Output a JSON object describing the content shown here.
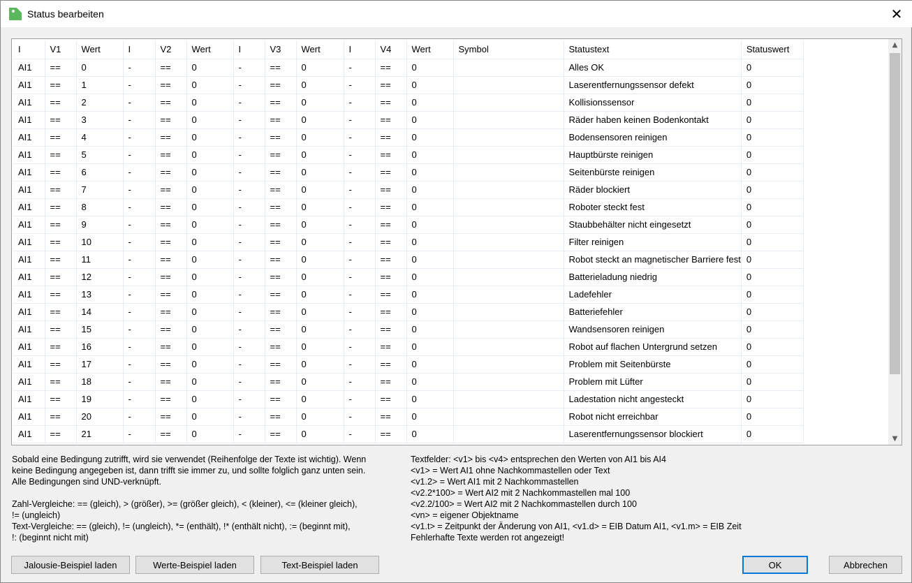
{
  "window": {
    "title": "Status bearbeiten",
    "close": "✕"
  },
  "table": {
    "headers": [
      "I",
      "V1",
      "Wert",
      "I",
      "V2",
      "Wert",
      "I",
      "V3",
      "Wert",
      "I",
      "V4",
      "Wert",
      "Symbol",
      "Statustext",
      "Statuswert"
    ],
    "rows": [
      [
        "AI1",
        "==",
        "0",
        "-",
        "==",
        "0",
        "-",
        "==",
        "0",
        "-",
        "==",
        "0",
        "",
        "Alles OK",
        "0"
      ],
      [
        "AI1",
        "==",
        "1",
        "-",
        "==",
        "0",
        "-",
        "==",
        "0",
        "-",
        "==",
        "0",
        "",
        "Laserentfernungssensor defekt",
        "0"
      ],
      [
        "AI1",
        "==",
        "2",
        "-",
        "==",
        "0",
        "-",
        "==",
        "0",
        "-",
        "==",
        "0",
        "",
        "Kollisionssensor",
        "0"
      ],
      [
        "AI1",
        "==",
        "3",
        "-",
        "==",
        "0",
        "-",
        "==",
        "0",
        "-",
        "==",
        "0",
        "",
        "Räder haben keinen Bodenkontakt",
        "0"
      ],
      [
        "AI1",
        "==",
        "4",
        "-",
        "==",
        "0",
        "-",
        "==",
        "0",
        "-",
        "==",
        "0",
        "",
        "Bodensensoren reinigen",
        "0"
      ],
      [
        "AI1",
        "==",
        "5",
        "-",
        "==",
        "0",
        "-",
        "==",
        "0",
        "-",
        "==",
        "0",
        "",
        "Hauptbürste reinigen",
        "0"
      ],
      [
        "AI1",
        "==",
        "6",
        "-",
        "==",
        "0",
        "-",
        "==",
        "0",
        "-",
        "==",
        "0",
        "",
        "Seitenbürste reinigen",
        "0"
      ],
      [
        "AI1",
        "==",
        "7",
        "-",
        "==",
        "0",
        "-",
        "==",
        "0",
        "-",
        "==",
        "0",
        "",
        "Räder blockiert",
        "0"
      ],
      [
        "AI1",
        "==",
        "8",
        "-",
        "==",
        "0",
        "-",
        "==",
        "0",
        "-",
        "==",
        "0",
        "",
        "Roboter steckt fest",
        "0"
      ],
      [
        "AI1",
        "==",
        "9",
        "-",
        "==",
        "0",
        "-",
        "==",
        "0",
        "-",
        "==",
        "0",
        "",
        "Staubbehälter nicht eingesetzt",
        "0"
      ],
      [
        "AI1",
        "==",
        "10",
        "-",
        "==",
        "0",
        "-",
        "==",
        "0",
        "-",
        "==",
        "0",
        "",
        "Filter reinigen",
        "0"
      ],
      [
        "AI1",
        "==",
        "11",
        "-",
        "==",
        "0",
        "-",
        "==",
        "0",
        "-",
        "==",
        "0",
        "",
        "Robot steckt an magnetischer Barriere fest",
        "0"
      ],
      [
        "AI1",
        "==",
        "12",
        "-",
        "==",
        "0",
        "-",
        "==",
        "0",
        "-",
        "==",
        "0",
        "",
        "Batterieladung niedrig",
        "0"
      ],
      [
        "AI1",
        "==",
        "13",
        "-",
        "==",
        "0",
        "-",
        "==",
        "0",
        "-",
        "==",
        "0",
        "",
        "Ladefehler",
        "0"
      ],
      [
        "AI1",
        "==",
        "14",
        "-",
        "==",
        "0",
        "-",
        "==",
        "0",
        "-",
        "==",
        "0",
        "",
        "Batteriefehler",
        "0"
      ],
      [
        "AI1",
        "==",
        "15",
        "-",
        "==",
        "0",
        "-",
        "==",
        "0",
        "-",
        "==",
        "0",
        "",
        "Wandsensoren reinigen",
        "0"
      ],
      [
        "AI1",
        "==",
        "16",
        "-",
        "==",
        "0",
        "-",
        "==",
        "0",
        "-",
        "==",
        "0",
        "",
        "Robot auf flachen Untergrund setzen",
        "0"
      ],
      [
        "AI1",
        "==",
        "17",
        "-",
        "==",
        "0",
        "-",
        "==",
        "0",
        "-",
        "==",
        "0",
        "",
        "Problem mit Seitenbürste",
        "0"
      ],
      [
        "AI1",
        "==",
        "18",
        "-",
        "==",
        "0",
        "-",
        "==",
        "0",
        "-",
        "==",
        "0",
        "",
        "Problem mit Lüfter",
        "0"
      ],
      [
        "AI1",
        "==",
        "19",
        "-",
        "==",
        "0",
        "-",
        "==",
        "0",
        "-",
        "==",
        "0",
        "",
        "Ladestation nicht angesteckt",
        "0"
      ],
      [
        "AI1",
        "==",
        "20",
        "-",
        "==",
        "0",
        "-",
        "==",
        "0",
        "-",
        "==",
        "0",
        "",
        "Robot nicht erreichbar",
        "0"
      ],
      [
        "AI1",
        "==",
        "21",
        "-",
        "==",
        "0",
        "-",
        "==",
        "0",
        "-",
        "==",
        "0",
        "",
        "Laserentfernungssensor blockiert",
        "0"
      ]
    ]
  },
  "help_left": [
    "Sobald eine Bedingung zutrifft, wird sie verwendet (Reihenfolge der Texte ist wichtig). Wenn",
    "keine Bedingung angegeben ist, dann trifft sie immer zu, und sollte folglich ganz unten sein.",
    "Alle Bedingungen sind UND-verknüpft.",
    "",
    "Zahl-Vergleiche: == (gleich), > (größer), >= (größer gleich), < (kleiner), <= (kleiner gleich),",
    "!= (ungleich)",
    "Text-Vergleiche: == (gleich), != (ungleich), *= (enthält), !* (enthält nicht), := (beginnt mit),",
    "!: (beginnt nicht mit)"
  ],
  "help_right": [
    "Textfelder: <v1> bis <v4> entsprechen den Werten von AI1 bis AI4",
    "<v1> = Wert AI1 ohne Nachkommastellen oder Text",
    "<v1.2> = Wert AI1 mit 2 Nachkommastellen",
    "<v2.2*100> = Wert AI2 mit 2 Nachkommastellen mal 100",
    "<v2.2/100> = Wert AI2 mit 2 Nachkommastellen durch 100",
    "<vn> = eigener Objektname",
    "<v1.t> = Zeitpunkt der Änderung von AI1, <v1.d> = EIB Datum AI1, <v1.m> = EIB Zeit",
    "Fehlerhafte Texte werden rot angezeigt!"
  ],
  "buttons": {
    "jalousie": "Jalousie-Beispiel laden",
    "werte": "Werte-Beispiel laden",
    "text": "Text-Beispiel laden",
    "ok": "OK",
    "cancel": "Abbrechen"
  }
}
